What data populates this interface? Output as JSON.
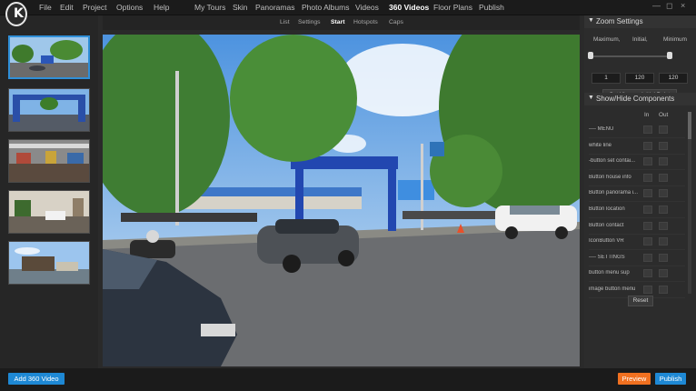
{
  "menu": {
    "items": [
      "File",
      "Edit",
      "Project",
      "Options",
      "Help",
      "My Tours",
      "Skin",
      "Panoramas",
      "Photo Albums",
      "Videos",
      "360 Videos",
      "Floor Plans",
      "Publish"
    ],
    "active_index": 10
  },
  "window_controls": {
    "minimize": "—",
    "maximize": "◻",
    "close": "×"
  },
  "subtabs": {
    "items": [
      "List",
      "Settings",
      "Start",
      "Hotspots",
      "Caps"
    ],
    "active_index": 2
  },
  "thumbnails": {
    "count": 5,
    "selected_index": 0
  },
  "zoom": {
    "title": "Zoom Settings",
    "labels": [
      "Maximum,",
      "Initial,",
      "Minimum"
    ],
    "values": [
      "1",
      "120",
      "120"
    ],
    "set_initial_label": "Set View as Initial Point"
  },
  "components": {
    "title": "Show/Hide Components",
    "col_in": "In",
    "col_out": "Out",
    "rows": [
      "---- MENU",
      "white line",
      "-button set contai...",
      "Button house info",
      "Button panorama i...",
      "Button location",
      "Button contact",
      "IconButton VR",
      "---- SETTINGS",
      "button menu sup",
      "image button menu"
    ],
    "reset_label": "Reset"
  },
  "bottom": {
    "add_label": "Add 360 Video",
    "preview_label": "Preview",
    "publish_label": "Publish"
  },
  "colors": {
    "accent_blue": "#1e88d4",
    "preview_orange": "#f07020"
  }
}
